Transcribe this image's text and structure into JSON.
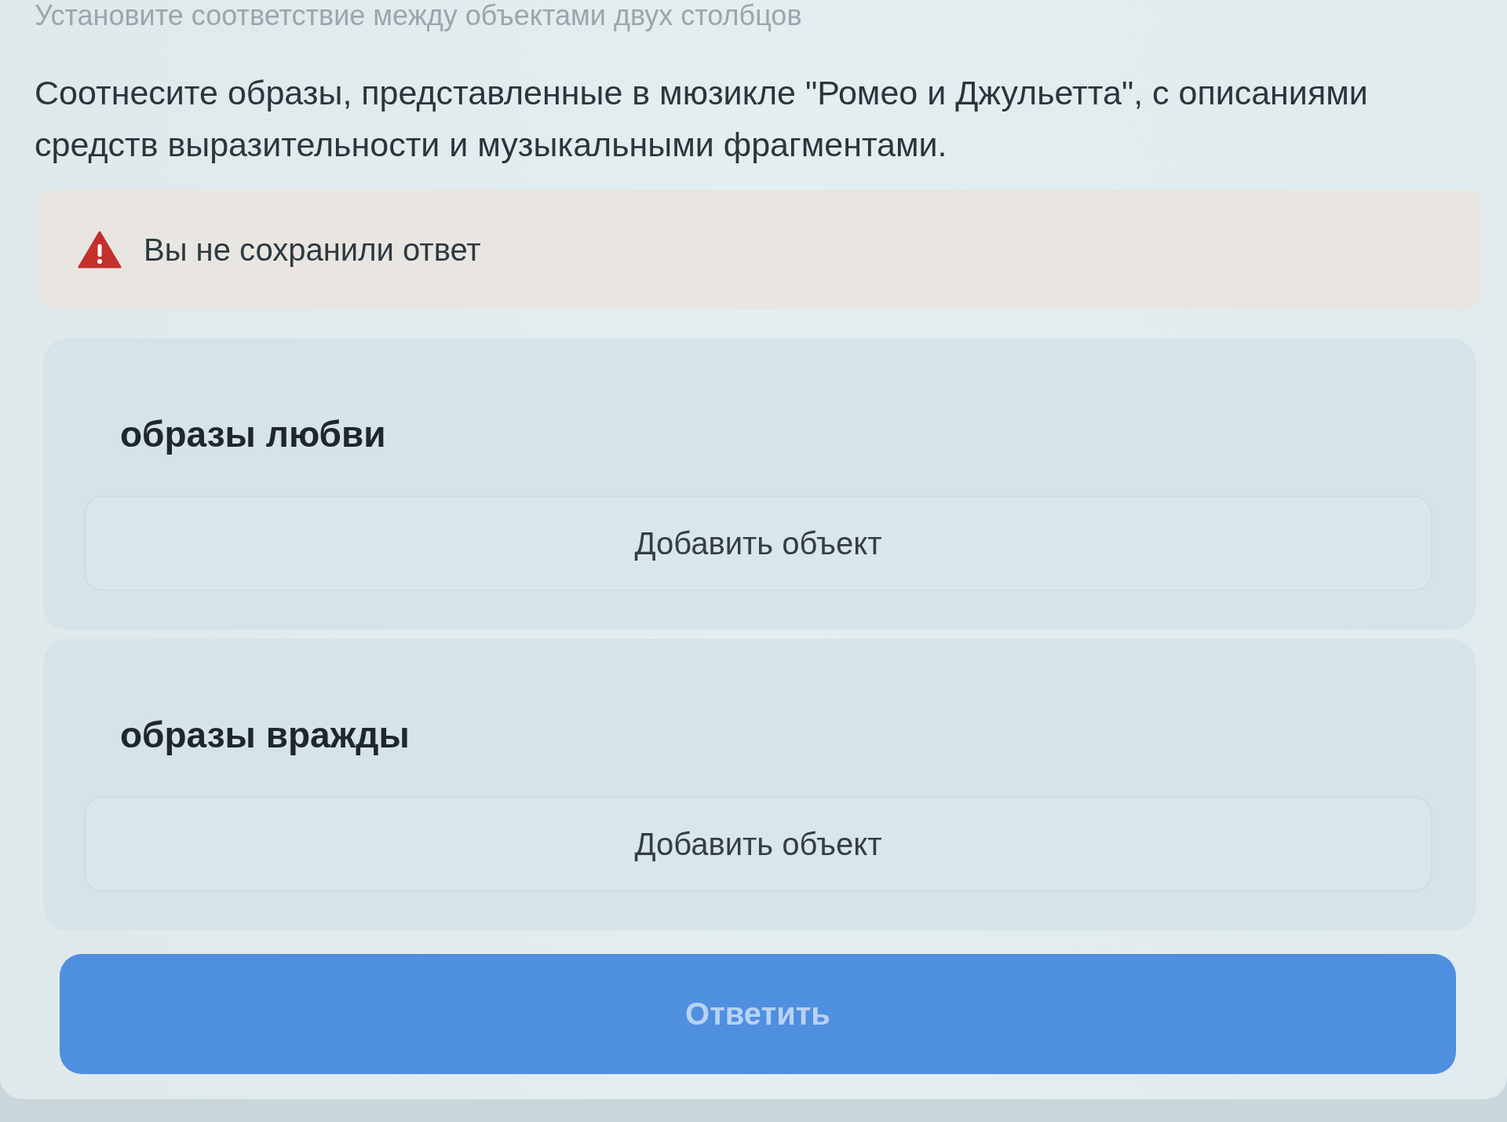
{
  "instruction": "Установите соответствие между объектами двух столбцов",
  "question": "Соотнесите образы, представленные в мюзикле \"Ромео и Джульетта\", с описаниями средств выразительности и музыкальными фрагментами.",
  "alert": {
    "kind": "warning",
    "text": "Вы не сохранили ответ"
  },
  "groups": [
    {
      "title": "образы любви",
      "add_label": "Добавить объект"
    },
    {
      "title": "образы вражды",
      "add_label": "Добавить объект"
    }
  ],
  "submit_button": {
    "label": "Ответить",
    "disabled": true
  }
}
